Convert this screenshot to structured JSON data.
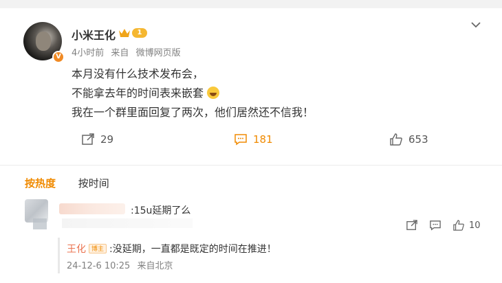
{
  "post": {
    "username": "小米王化",
    "level": "1",
    "verified_mark": "V",
    "time": "4小时前",
    "source_prefix": "来自",
    "source": "微博网页版",
    "lines": [
      "本月没有什么技术发布会，",
      "不能拿去年的时间表来嵌套",
      "我在一个群里面回复了两次，他们居然还不信我！"
    ],
    "actions": {
      "repost_count": "29",
      "comment_count": "181",
      "like_count": "653"
    }
  },
  "sort_tabs": [
    {
      "label": "按热度",
      "active": true
    },
    {
      "label": "按时间",
      "active": false
    }
  ],
  "comment": {
    "text": ":15u延期了么",
    "like_count": "10"
  },
  "reply": {
    "author": "王化",
    "badge": "博主",
    "text": ":没延期，一直都是既定的时间在推进！",
    "date": "24-12-6 10:25",
    "location": "来自北京"
  },
  "colors": {
    "accent": "#f08a00",
    "reply_name": "#eb7350",
    "meta_gray": "#808080"
  }
}
